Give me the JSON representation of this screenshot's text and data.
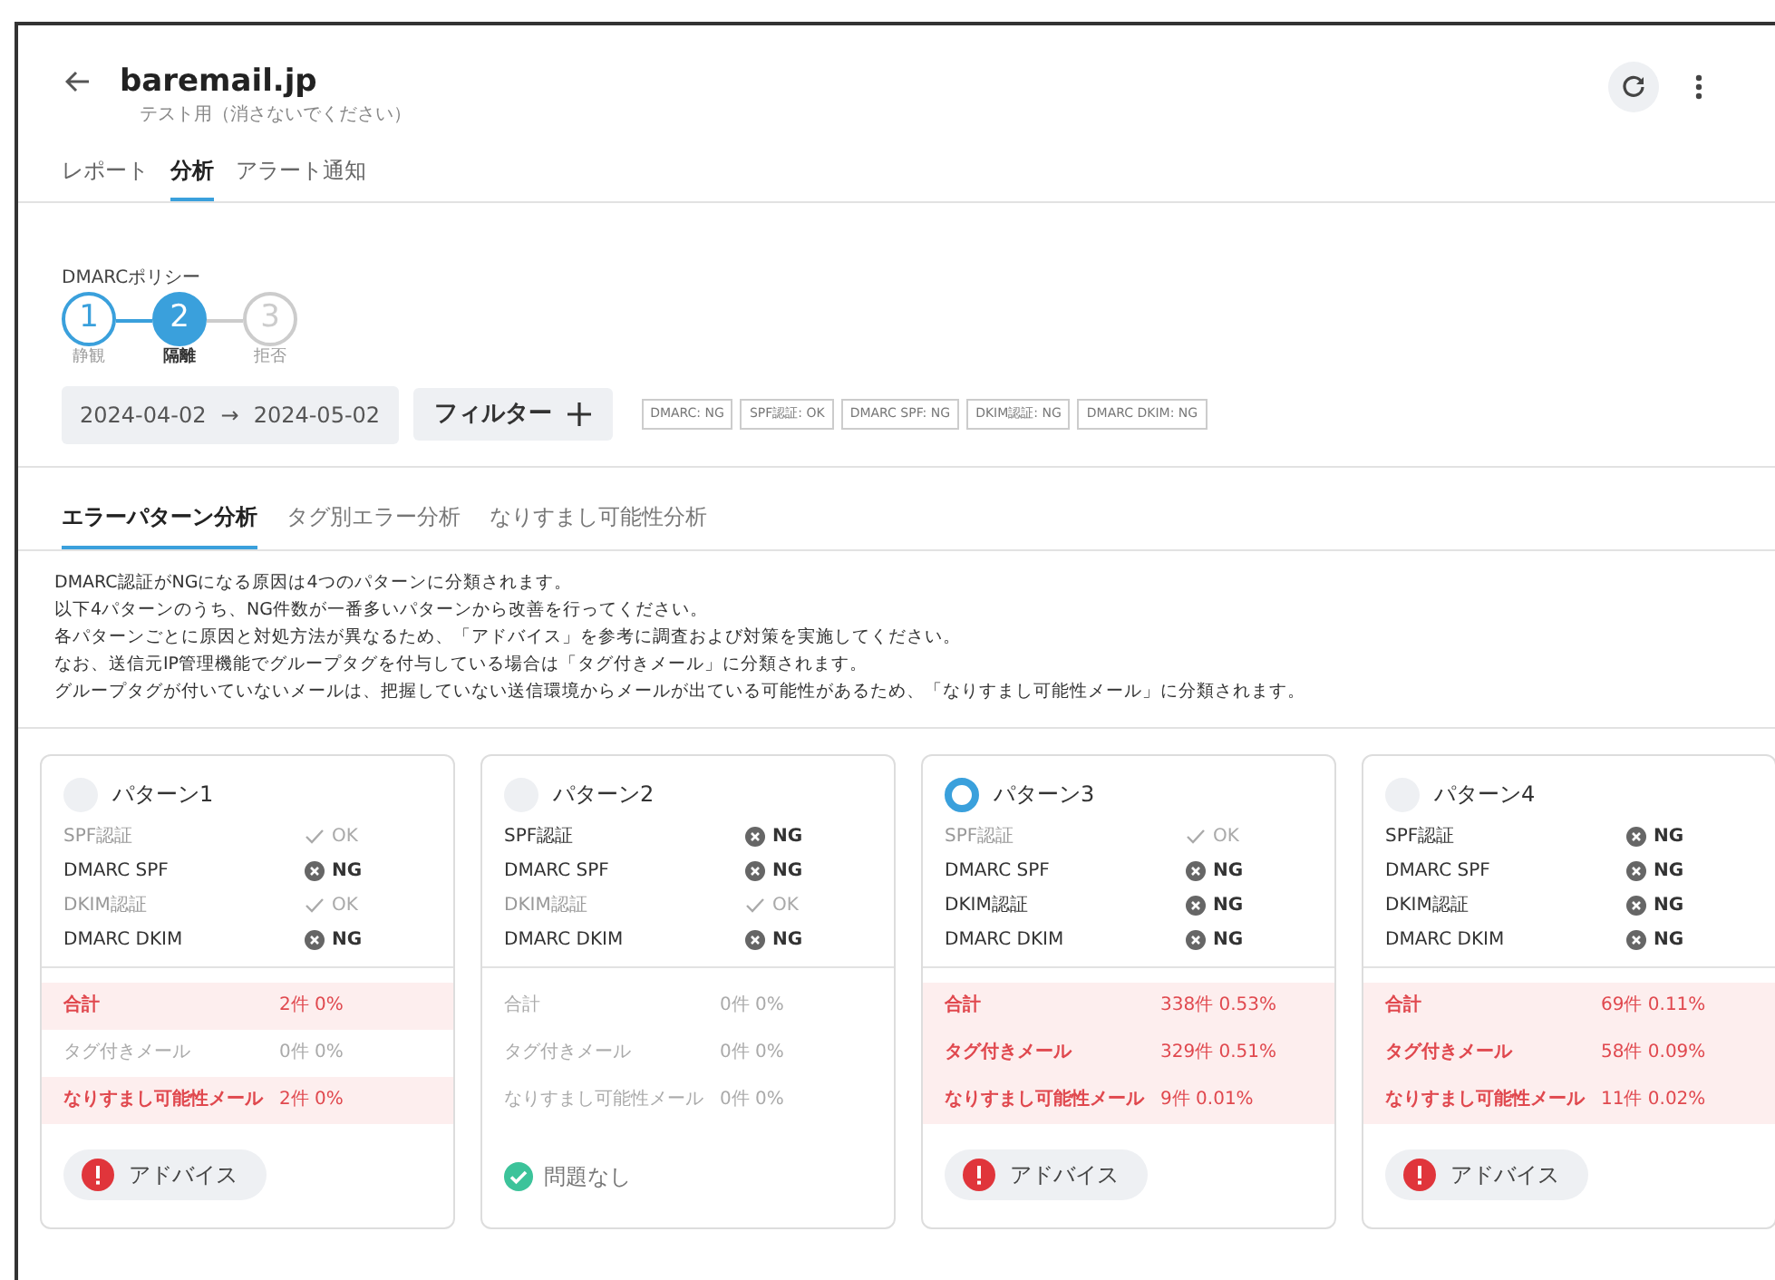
{
  "header": {
    "title": "baremail.jp",
    "subtitle": "テスト用（消さないでください）"
  },
  "tabs": [
    {
      "label": "レポート",
      "selected": false
    },
    {
      "label": "分析",
      "selected": true
    },
    {
      "label": "アラート通知",
      "selected": false
    }
  ],
  "policy": {
    "label": "DMARCポリシー",
    "steps": [
      {
        "number": "1",
        "label": "静観",
        "done": true,
        "selected": false
      },
      {
        "number": "2",
        "label": "隔離",
        "done": false,
        "selected": true
      },
      {
        "number": "3",
        "label": "拒否",
        "done": false,
        "selected": false
      }
    ]
  },
  "date_range": {
    "from": "2024-04-02",
    "arrow": "→",
    "to": "2024-05-02"
  },
  "filter_button": "フィルター",
  "filter_chips": [
    "DMARC: NG",
    "SPF認証: OK",
    "DMARC SPF: NG",
    "DKIM認証: NG",
    "DMARC DKIM: NG"
  ],
  "sub_tabs": [
    {
      "label": "エラーパターン分析",
      "selected": true
    },
    {
      "label": "タグ別エラー分析",
      "selected": false
    },
    {
      "label": "なりすまし可能性分析",
      "selected": false
    }
  ],
  "description": [
    "DMARC認証がNGになる原因は4つのパターンに分類されます。",
    "以下4パターンのうち、NG件数が一番多いパターンから改善を行ってください。",
    "各パターンごとに原因と対処方法が異なるため、「アドバイス」を参考に調査および対策を実施してください。",
    "なお、送信元IP管理機能でグループタグを付与している場合は「タグ付きメール」に分類されます。",
    "グループタグが付いていないメールは、把握していない送信環境からメールが出ている可能性があるため、「なりすまし可能性メール」に分類されます。"
  ],
  "patterns": [
    {
      "title": "パターン1",
      "selected": false,
      "checks": [
        {
          "label": "SPF認証",
          "result": "OK",
          "kind": "ok"
        },
        {
          "label": "DMARC SPF",
          "result": "NG",
          "kind": "ng"
        },
        {
          "label": "DKIM認証",
          "result": "OK",
          "kind": "ok"
        },
        {
          "label": "DMARC DKIM",
          "result": "NG",
          "kind": "ng"
        }
      ],
      "summary": [
        {
          "label": "合計",
          "value": "2件 0%",
          "alert": true
        },
        {
          "label": "タグ付きメール",
          "value": "0件 0%",
          "alert": false
        },
        {
          "label": "なりすまし可能性メール",
          "value": "2件 0%",
          "alert": true
        }
      ],
      "footer": {
        "kind": "advice",
        "label": "アドバイス"
      }
    },
    {
      "title": "パターン2",
      "selected": false,
      "checks": [
        {
          "label": "SPF認証",
          "result": "NG",
          "kind": "ng"
        },
        {
          "label": "DMARC SPF",
          "result": "NG",
          "kind": "ng"
        },
        {
          "label": "DKIM認証",
          "result": "OK",
          "kind": "ok"
        },
        {
          "label": "DMARC DKIM",
          "result": "NG",
          "kind": "ng"
        }
      ],
      "summary": [
        {
          "label": "合計",
          "value": "0件 0%",
          "alert": false
        },
        {
          "label": "タグ付きメール",
          "value": "0件 0%",
          "alert": false
        },
        {
          "label": "なりすまし可能性メール",
          "value": "0件 0%",
          "alert": false
        }
      ],
      "footer": {
        "kind": "ok",
        "label": "問題なし"
      }
    },
    {
      "title": "パターン3",
      "selected": true,
      "checks": [
        {
          "label": "SPF認証",
          "result": "OK",
          "kind": "ok"
        },
        {
          "label": "DMARC SPF",
          "result": "NG",
          "kind": "ng"
        },
        {
          "label": "DKIM認証",
          "result": "NG",
          "kind": "ng"
        },
        {
          "label": "DMARC DKIM",
          "result": "NG",
          "kind": "ng"
        }
      ],
      "summary": [
        {
          "label": "合計",
          "value": "338件 0.53%",
          "alert": true
        },
        {
          "label": "タグ付きメール",
          "value": "329件 0.51%",
          "alert": true
        },
        {
          "label": "なりすまし可能性メール",
          "value": "9件 0.01%",
          "alert": true
        }
      ],
      "footer": {
        "kind": "advice",
        "label": "アドバイス"
      }
    },
    {
      "title": "パターン4",
      "selected": false,
      "checks": [
        {
          "label": "SPF認証",
          "result": "NG",
          "kind": "ng"
        },
        {
          "label": "DMARC SPF",
          "result": "NG",
          "kind": "ng"
        },
        {
          "label": "DKIM認証",
          "result": "NG",
          "kind": "ng"
        },
        {
          "label": "DMARC DKIM",
          "result": "NG",
          "kind": "ng"
        }
      ],
      "summary": [
        {
          "label": "合計",
          "value": "69件 0.11%",
          "alert": true
        },
        {
          "label": "タグ付きメール",
          "value": "58件 0.09%",
          "alert": true
        },
        {
          "label": "なりすまし可能性メール",
          "value": "11件 0.02%",
          "alert": true
        }
      ],
      "footer": {
        "kind": "advice",
        "label": "アドバイス"
      }
    }
  ]
}
